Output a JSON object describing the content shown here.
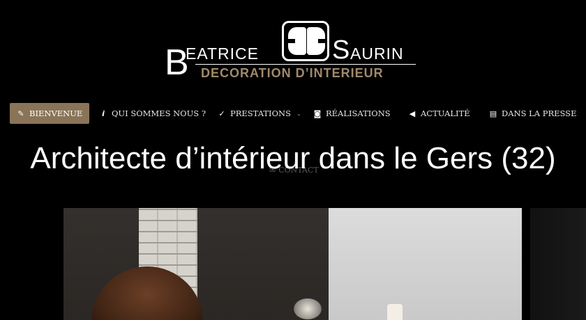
{
  "logo": {
    "big_b": "B",
    "first_name": "EATRICE",
    "big_s": "S",
    "last_name": "AURIN",
    "subtitle": "DECORATION D’INTERIEUR"
  },
  "nav": {
    "items": [
      {
        "label": "BIENVENUE",
        "icon": "pencil-icon",
        "glyph": "✎"
      },
      {
        "label": "QUI SOMMES NOUS ?",
        "icon": "info-icon",
        "glyph": "i"
      },
      {
        "label": "PRESTATIONS",
        "icon": "check-icon",
        "glyph": "✓"
      },
      {
        "label": "RÉALISATIONS",
        "icon": "camera-icon",
        "glyph": "◙"
      },
      {
        "label": "ACTUALITÉ",
        "icon": "megaphone-icon",
        "glyph": "◀"
      },
      {
        "label": "DANS LA PRESSE",
        "icon": "newspaper-icon",
        "glyph": "▤"
      }
    ],
    "dropdown_glyph": "⌄",
    "contact_label": "CONTACT"
  },
  "page": {
    "title": "Architecte d’intérieur dans le Gers (32)"
  },
  "colors": {
    "background": "#000000",
    "accent": "#8a7458",
    "logo_subtitle": "#a08a6c"
  }
}
